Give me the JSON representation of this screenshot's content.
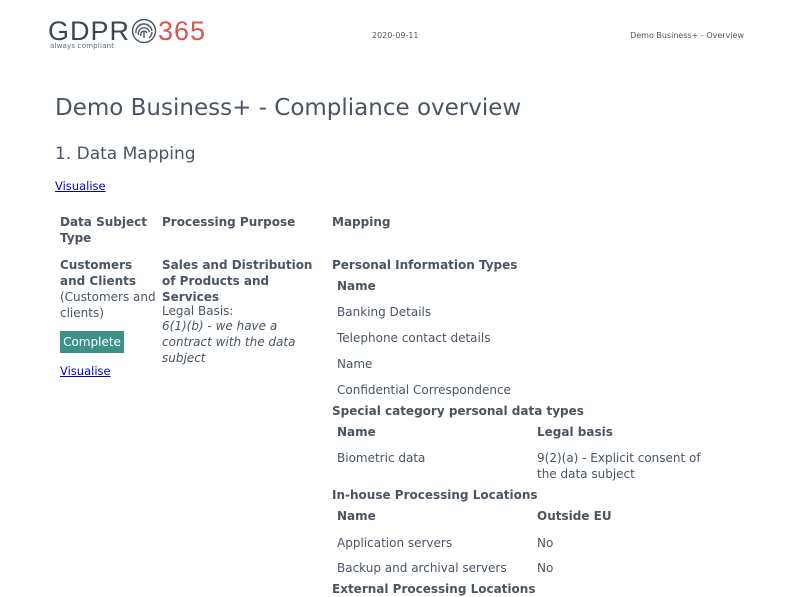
{
  "header": {
    "logo_gdpr": "GDPR",
    "logo_365": "365",
    "logo_tagline": "always compliant",
    "date": "2020-09-11",
    "doc_name": "Demo Business+ - Overview"
  },
  "title": "Demo Business+ - Compliance overview",
  "section": {
    "title": "1. Data Mapping",
    "visualise_link": "Visualise"
  },
  "table": {
    "headers": {
      "data_subject_type": "Data Subject Type",
      "processing_purpose": "Processing Purpose",
      "mapping": "Mapping"
    },
    "row": {
      "subject_name": "Customers and Clients",
      "subject_desc": "(Customers and clients)",
      "status": "Complete",
      "visualise_link": "Visualise",
      "purpose": "Sales and Distribution of Products and Services",
      "legal_basis_label": "Legal Basis:",
      "legal_basis_value": "6(1)(b) - we have a contract with the data subject"
    },
    "mapping": {
      "personal_info": {
        "title": "Personal Information Types",
        "col_name": "Name",
        "items": [
          "Banking Details",
          "Telephone contact details",
          "Name",
          "Confidential Correspondence"
        ]
      },
      "special_category": {
        "title": "Special category personal data types",
        "col_name": "Name",
        "col_legal": "Legal basis",
        "rows": [
          {
            "name": "Biometric data",
            "legal": "9(2)(a) - Explicit consent of the data subject"
          }
        ]
      },
      "inhouse": {
        "title": "In-house Processing Locations",
        "col_name": "Name",
        "col_outside": "Outside EU",
        "rows": [
          {
            "name": "Application servers",
            "outside": "No"
          },
          {
            "name": "Backup and archival servers",
            "outside": "No"
          }
        ]
      },
      "external": {
        "title": "External Processing Locations"
      }
    }
  }
}
